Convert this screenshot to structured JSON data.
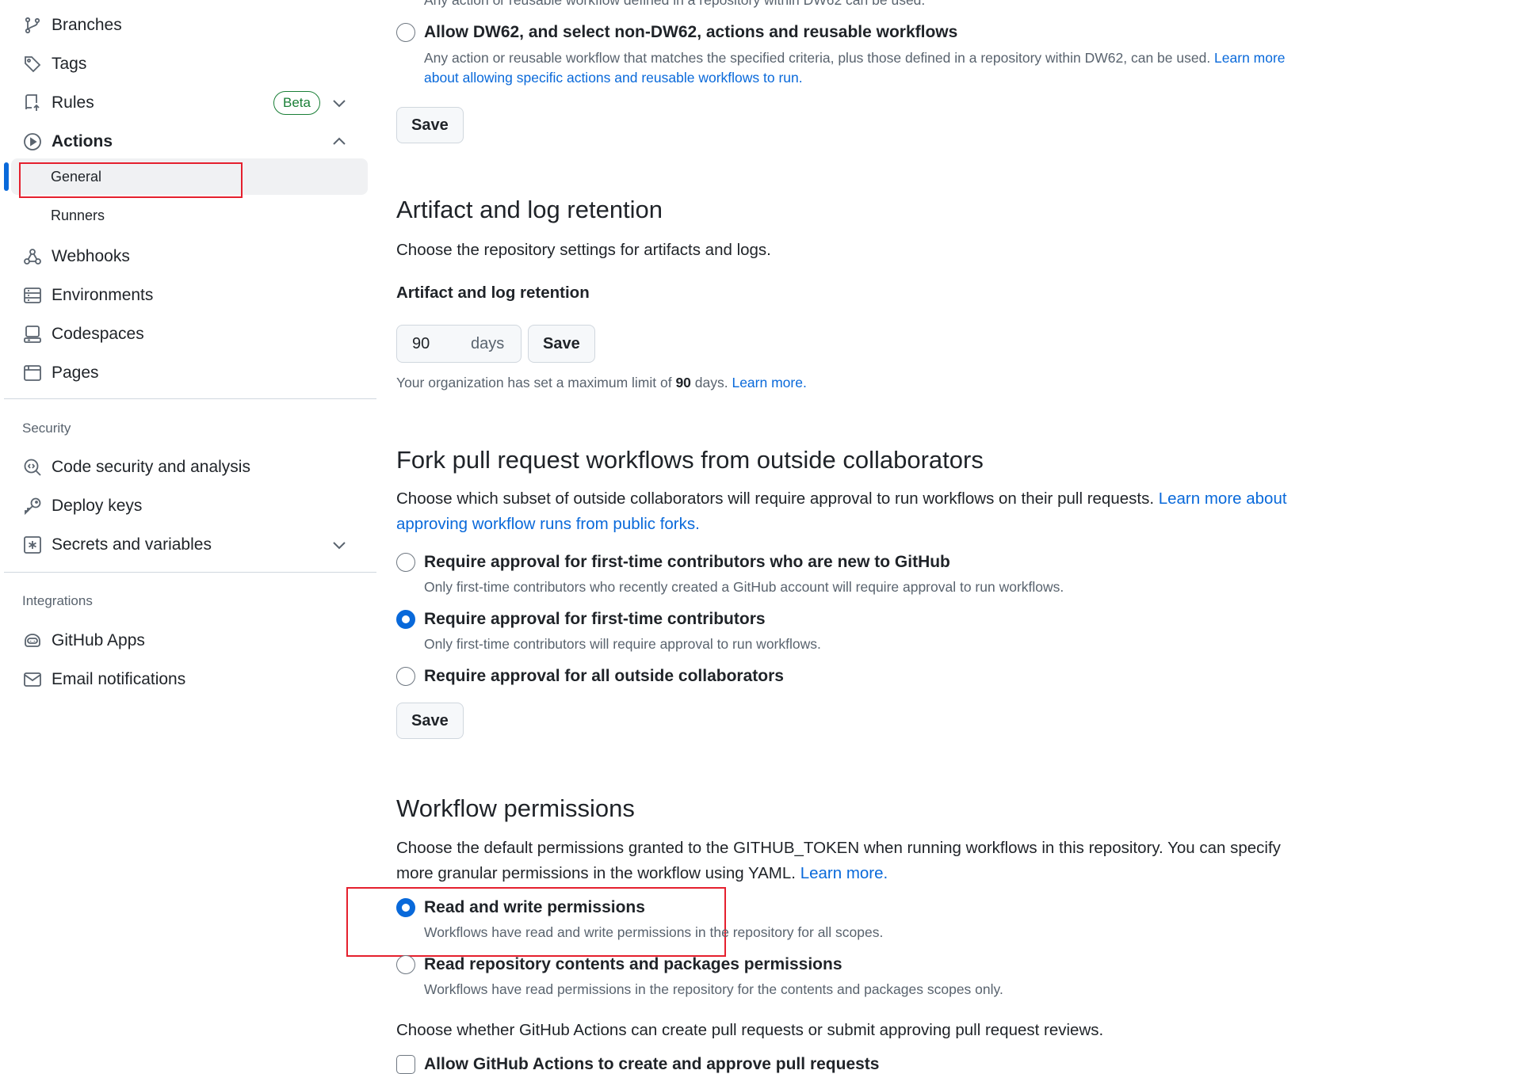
{
  "sidebar": {
    "items": [
      {
        "label": "Branches"
      },
      {
        "label": "Tags"
      },
      {
        "label": "Rules",
        "badge": "Beta"
      },
      {
        "label": "Actions"
      },
      {
        "label": "General"
      },
      {
        "label": "Runners"
      },
      {
        "label": "Webhooks"
      },
      {
        "label": "Environments"
      },
      {
        "label": "Codespaces"
      },
      {
        "label": "Pages"
      }
    ],
    "security": {
      "title": "Security",
      "items": [
        {
          "label": "Code security and analysis"
        },
        {
          "label": "Deploy keys"
        },
        {
          "label": "Secrets and variables"
        }
      ]
    },
    "integrations": {
      "title": "Integrations",
      "items": [
        {
          "label": "GitHub Apps"
        },
        {
          "label": "Email notifications"
        }
      ]
    }
  },
  "policy": {
    "cut_desc": "Any action or reusable workflow defined in a repository within DW62 can be used.",
    "option_title": "Allow DW62, and select non-DW62, actions and reusable workflows",
    "option_desc": "Any action or reusable workflow that matches the specified criteria, plus those defined in a repository within DW62, can be used. ",
    "option_link": "Learn more about allowing specific actions and reusable workflows to run.",
    "save": "Save"
  },
  "artifact": {
    "heading": "Artifact and log retention",
    "description": "Choose the repository settings for artifacts and logs.",
    "label": "Artifact and log retention",
    "value": "90",
    "unit": "days",
    "save": "Save",
    "note_prefix": "Your organization has set a maximum limit of ",
    "note_value": "90",
    "note_suffix": " days. ",
    "note_link": "Learn more."
  },
  "fork": {
    "heading": "Fork pull request workflows from outside collaborators",
    "description": "Choose which subset of outside collaborators will require approval to run workflows on their pull requests. ",
    "link": "Learn more about approving workflow runs from public forks.",
    "options": [
      {
        "title": "Require approval for first-time contributors who are new to GitHub",
        "desc": "Only first-time contributors who recently created a GitHub account will require approval to run workflows.",
        "checked": false
      },
      {
        "title": "Require approval for first-time contributors",
        "desc": "Only first-time contributors will require approval to run workflows.",
        "checked": true
      },
      {
        "title": "Require approval for all outside collaborators",
        "desc": "",
        "checked": false
      }
    ],
    "save": "Save"
  },
  "workflow": {
    "heading": "Workflow permissions",
    "description": "Choose the default permissions granted to the GITHUB_TOKEN when running workflows in this repository. You can specify more granular permissions in the workflow using YAML. ",
    "link": "Learn more.",
    "options": [
      {
        "title": "Read and write permissions",
        "desc": "Workflows have read and write permissions in the repository for all scopes.",
        "checked": true
      },
      {
        "title": "Read repository contents and packages permissions",
        "desc": "Workflows have read permissions in the repository for the contents and packages scopes only.",
        "checked": false
      }
    ],
    "pr_description": "Choose whether GitHub Actions can create pull requests or submit approving pull request reviews.",
    "checkbox_label": "Allow GitHub Actions to create and approve pull requests"
  },
  "colors": {
    "accent": "#0969da",
    "success": "#1a7f37",
    "highlight": "#e5202e"
  }
}
